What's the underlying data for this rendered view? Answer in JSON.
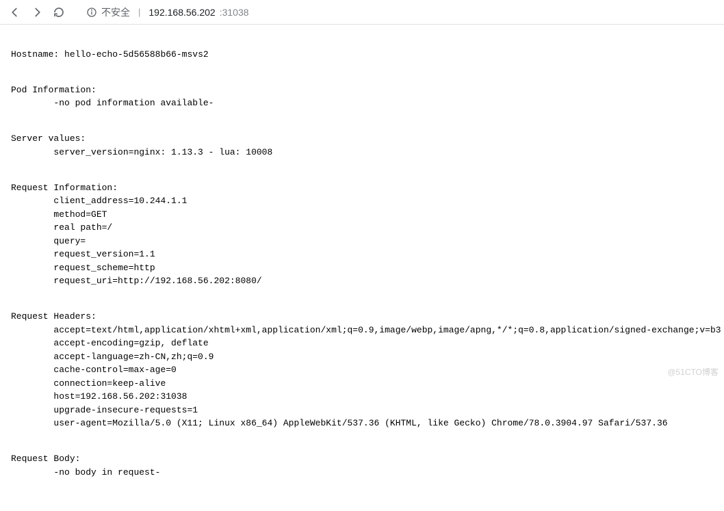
{
  "toolbar": {
    "security_label": "不安全",
    "url_host": "192.168.56.202",
    "url_port": ":31038"
  },
  "content": {
    "hostname_label": "Hostname:",
    "hostname_value": "hello-echo-5d56588b66-msvs2",
    "pod_info_label": "Pod Information:",
    "pod_info_value": "-no pod information available-",
    "server_values_label": "Server values:",
    "server_values_value": "server_version=nginx: 1.13.3 - lua: 10008",
    "request_info_label": "Request Information:",
    "request_info_lines": {
      "l0": "client_address=10.244.1.1",
      "l1": "method=GET",
      "l2": "real path=/",
      "l3": "query=",
      "l4": "request_version=1.1",
      "l5": "request_scheme=http",
      "l6": "request_uri=http://192.168.56.202:8080/"
    },
    "request_headers_label": "Request Headers:",
    "request_headers_lines": {
      "l0": "accept=text/html,application/xhtml+xml,application/xml;q=0.9,image/webp,image/apng,*/*;q=0.8,application/signed-exchange;v=b3",
      "l1": "accept-encoding=gzip, deflate",
      "l2": "accept-language=zh-CN,zh;q=0.9",
      "l3": "cache-control=max-age=0",
      "l4": "connection=keep-alive",
      "l5": "host=192.168.56.202:31038",
      "l6": "upgrade-insecure-requests=1",
      "l7": "user-agent=Mozilla/5.0 (X11; Linux x86_64) AppleWebKit/537.36 (KHTML, like Gecko) Chrome/78.0.3904.97 Safari/537.36"
    },
    "request_body_label": "Request Body:",
    "request_body_value": "-no body in request-"
  },
  "watermark": "@51CTO博客"
}
